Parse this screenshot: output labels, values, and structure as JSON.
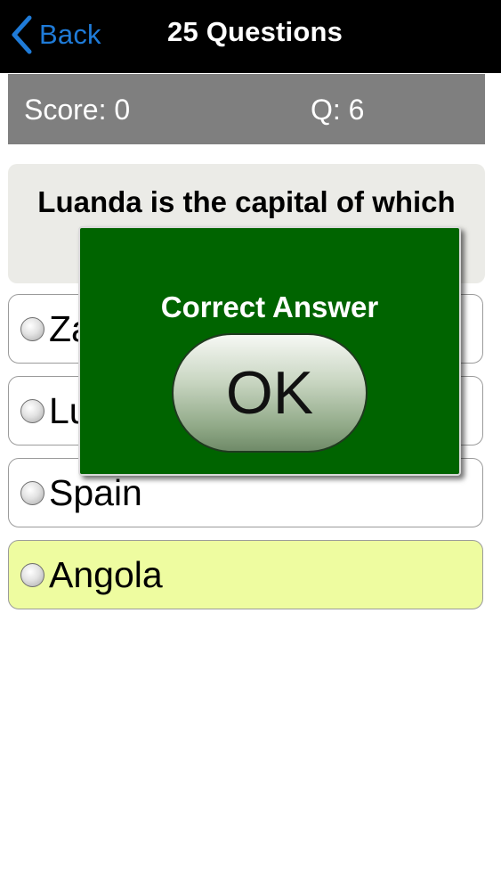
{
  "navbar": {
    "back_label": "Back",
    "title": "25 Questions",
    "back_color": "#1f7bd8"
  },
  "scorebar": {
    "score_text": "Score: 0",
    "question_text": "Q: 6"
  },
  "question": {
    "text": "Luanda is the capital of which"
  },
  "options": [
    {
      "label": "Za",
      "state": "default"
    },
    {
      "label": "Lu",
      "state": "default"
    },
    {
      "label": "Spain",
      "state": "default"
    },
    {
      "label": "Angola",
      "state": "correct"
    }
  ],
  "modal": {
    "title": "Correct Answer",
    "button_label": "OK",
    "background_color": "#006400"
  },
  "colors": {
    "correct_highlight": "#eefca0",
    "scorebar_bg": "#7f7f7f",
    "question_bg": "#ebebe7"
  },
  "icons": {
    "back": "chevron-left-icon",
    "radio": "radio-unchecked-icon"
  }
}
